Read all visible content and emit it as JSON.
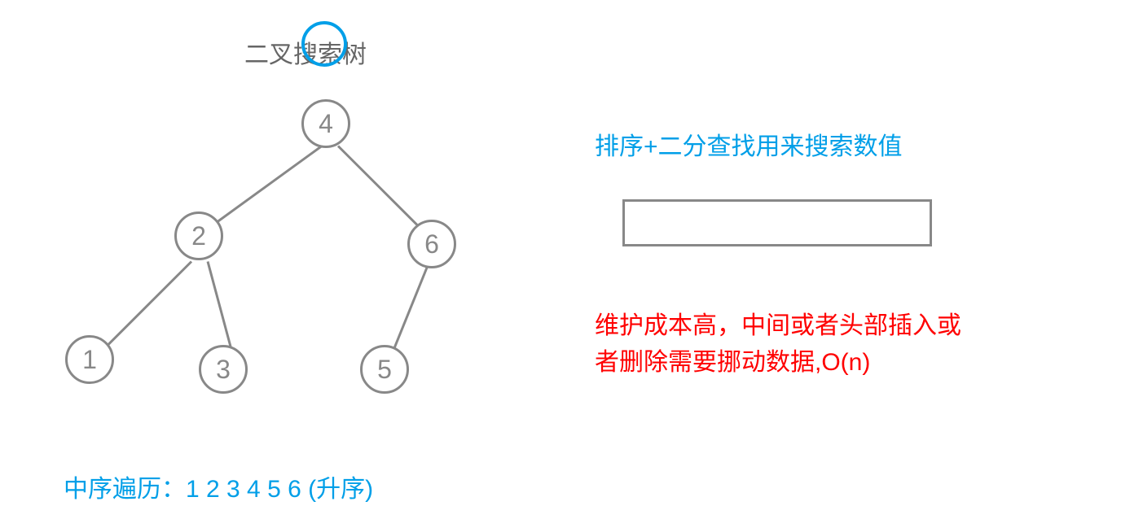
{
  "title": "二叉搜索树",
  "tree": {
    "nodes": {
      "root": "4",
      "n2": "2",
      "n6": "6",
      "n1": "1",
      "n3": "3",
      "n5": "5"
    }
  },
  "traversal": "中序遍历：1 2 3 4 5 6 (升序)",
  "right_blue": "排序+二分查找用来搜索数值",
  "right_red": "维护成本高，中间或者头部插入或\n者删除需要挪动数据,O(n)",
  "colors": {
    "blue": "#009fe8",
    "red": "#ff0000",
    "gray": "#888888",
    "title_gray": "#666666"
  }
}
